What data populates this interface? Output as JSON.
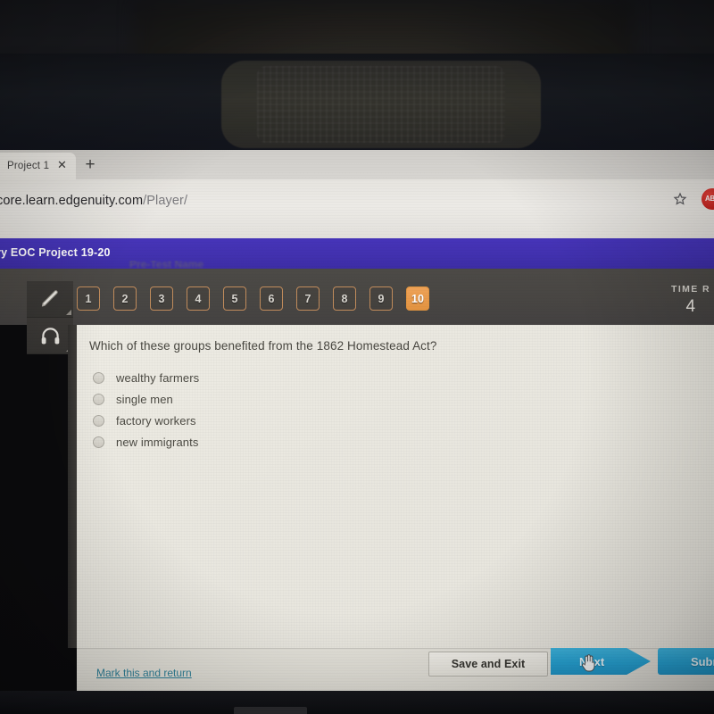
{
  "browser": {
    "tab_title": "Project 1",
    "close_icon": "close-icon",
    "newtab_icon": "plus-icon",
    "url_host": "core.learn.edgenuity.com",
    "url_path": "/Player/",
    "star_icon": "★",
    "extension_badge": "ABP"
  },
  "app": {
    "header_title": "ry EOC Project 19-20",
    "ghost_subheader": "Pre-Test     Name"
  },
  "tools": [
    {
      "name": "highlighter-tool",
      "icon": "pencil-icon"
    },
    {
      "name": "text-to-speech-tool",
      "icon": "headphones-icon"
    }
  ],
  "question_nav": {
    "numbers": [
      "1",
      "2",
      "3",
      "4",
      "5",
      "6",
      "7",
      "8",
      "9",
      "10"
    ],
    "active": "10"
  },
  "timer": {
    "label": "TIME R",
    "value": "4"
  },
  "question": {
    "text": "Which of these groups benefited from the 1862 Homestead Act?",
    "choices": [
      {
        "label": "wealthy farmers",
        "selected": false
      },
      {
        "label": "single men",
        "selected": false
      },
      {
        "label": "factory workers",
        "selected": false
      },
      {
        "label": "new immigrants",
        "selected": false
      }
    ]
  },
  "footer": {
    "mark_link": "Mark this and return",
    "save_button": "Save and Exit",
    "next_button": "Next",
    "submit_button": "Subm"
  },
  "colors": {
    "app_purple": "#4030ae",
    "accent_orange": "#e2913f",
    "action_blue": "#26a2d2",
    "link_teal": "#2f7f96",
    "panel_bg": "#e9e7df",
    "nav_dark": "#474542"
  }
}
